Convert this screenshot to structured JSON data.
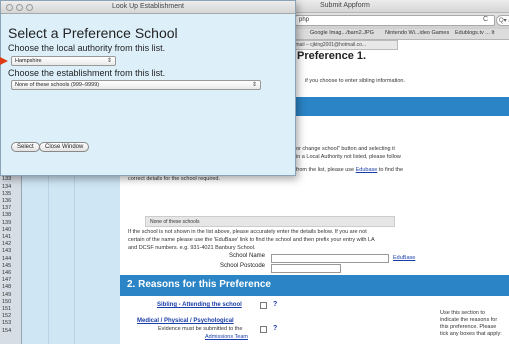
{
  "browser": {
    "address": "php",
    "search_placeholder": "Q▾ a",
    "title": "Submit Appform",
    "bookmarks": [
      "Google Imag.../barn2.JPG",
      "Nintendo Wi...ideo Games",
      "Edublogs.tv ... It"
    ],
    "tab": "tmail – cjking2001@hotmail.co..."
  },
  "rows": [
    "126",
    "127",
    "128",
    "129",
    "130",
    "131",
    "132",
    "133",
    "134",
    "135",
    "136",
    "137",
    "138",
    "139",
    "140",
    "141",
    "142",
    "143",
    "144",
    "145",
    "146",
    "147",
    "148",
    "149",
    "150",
    "151",
    "152",
    "153",
    "154"
  ],
  "page": {
    "pref_heading": "Preference 1.",
    "sib_info": "if you choose to enter sibling information.",
    "line_change1": "or change school\" button and selecting it",
    "line_change2": "in a Local Authority not listed, please follow",
    "line_list": "from the list, please use",
    "edubase_link": "Edubase",
    "line_list_end": "to find the",
    "correct_details": "correct details for the school required.",
    "school_box": "None of these schools",
    "instructions1": "If the school is not shown in the list above, please accurately enter the details below. If you are not",
    "instructions2": "certain of the name please use the 'EduBase' link to find the school and then prefix your entry with LA",
    "instructions3": "and DCSF numbers. e.g. 931-4021 Banbury School.",
    "school_name_label": "School Name",
    "school_postcode_label": "School Postcode",
    "edubase_link2": "EduBase",
    "section_title": "2. Reasons for this Preference",
    "sibling_link": "Sibling - Attending the school",
    "medical_link": "Medical / Physical / Psychological",
    "evidence_text": "Evidence must be submitted to the",
    "admissions_link": "Admissions Team",
    "qmark": "?",
    "side_note": "Use this section to indicate the reasons for this preference. Please tick any boxes that apply:"
  },
  "modal": {
    "title": "Look Up Establishment",
    "heading": "Select a Preference School",
    "sub_la": "Choose the local authority from this list.",
    "la_value": "Hampshire",
    "sub_est": "Choose the establishment from this list.",
    "est_value": "None of these schools (999–9999)",
    "select_button": "Select",
    "close_button": "Close Window"
  }
}
